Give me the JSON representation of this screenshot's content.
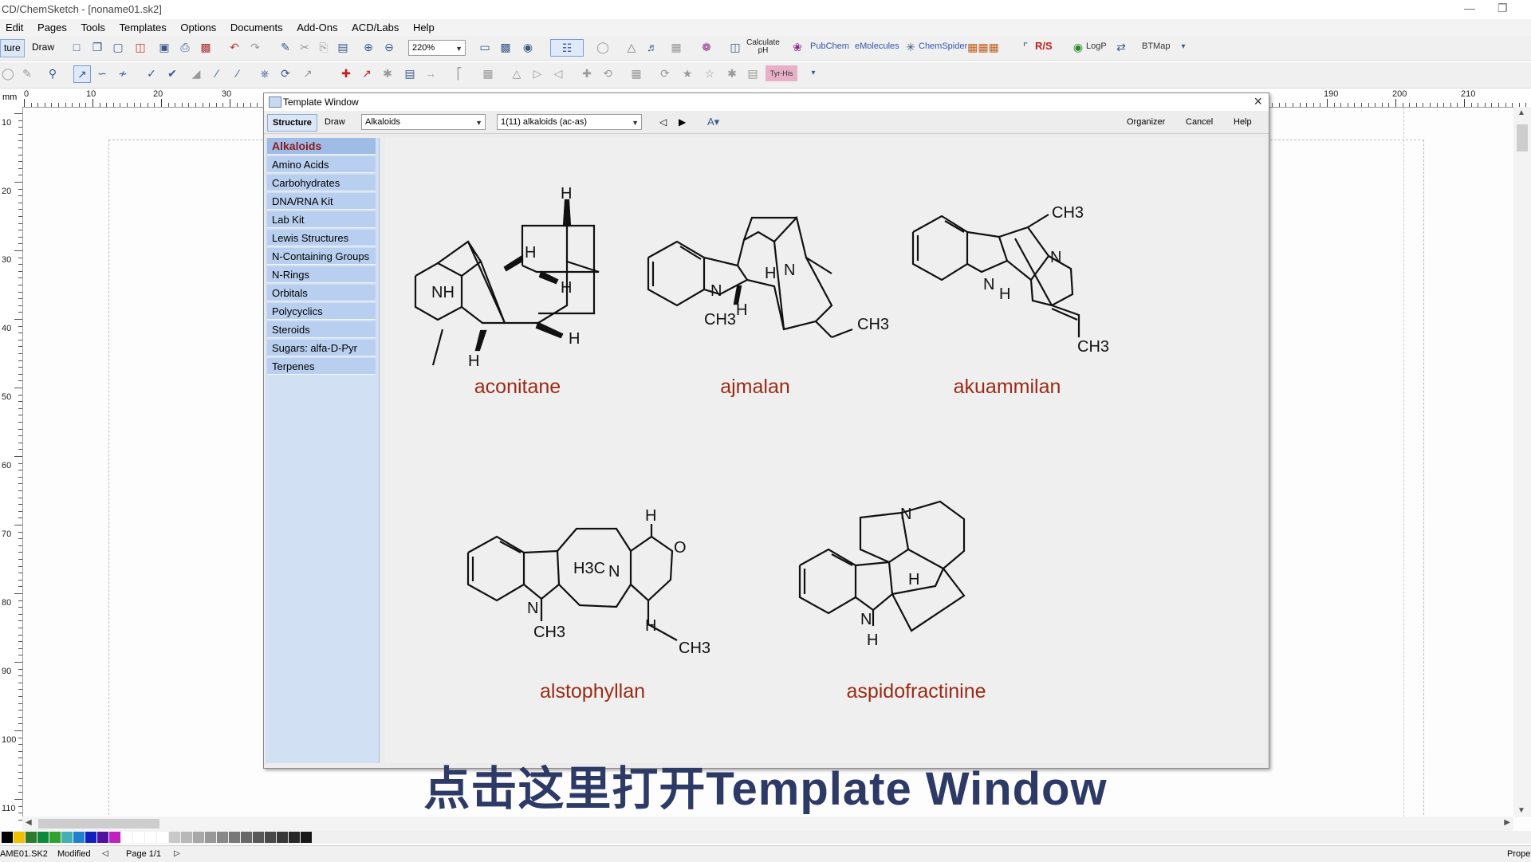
{
  "window": {
    "title": "CD/ChemSketch - [noname01.sk2]"
  },
  "menu": [
    "Edit",
    "Pages",
    "Tools",
    "Templates",
    "Options",
    "Documents",
    "Add-Ons",
    "ACD/Labs",
    "Help"
  ],
  "toolbar": {
    "structure_mode": "ture",
    "draw_mode": "Draw",
    "zoom": "220%",
    "calculate_label": "Calculate pH",
    "pubchem": "PubChem",
    "emolecules": "eMolecules",
    "chemspider": "ChemSpider",
    "rs": "R/S",
    "logp": "LogP",
    "btmap": "BTMap",
    "tyrhis": "Tyr-His"
  },
  "ruler": {
    "unit": "mm",
    "top_labels": [
      "0",
      "10",
      "20",
      "30",
      "190",
      "200",
      "210"
    ],
    "left_labels": [
      "10",
      "20",
      "30",
      "40",
      "50",
      "60",
      "70",
      "80",
      "90",
      "100",
      "110"
    ]
  },
  "template_window": {
    "title": "Template Window",
    "tab_structure": "Structure",
    "tab_draw": "Draw",
    "category_value": "Alkaloids",
    "page_value": "1(11) alkaloids (ac-as)",
    "organizer": "Organizer",
    "cancel": "Cancel",
    "help": "Help",
    "categories": [
      "Alkaloids",
      "Amino Acids",
      "Carbohydrates",
      "DNA/RNA Kit",
      "Lab Kit",
      "Lewis Structures",
      "N-Containing Groups",
      "N-Rings",
      "Orbitals",
      "Polycyclics",
      "Steroids",
      "Sugars: alfa-D-Pyr",
      "Terpenes"
    ],
    "selected_category": "Alkaloids",
    "molecules": [
      "aconitane",
      "ajmalan",
      "akuammilan",
      "alstophyllan",
      "aspidofractinine"
    ],
    "atom_labels": {
      "H": "H",
      "NH": "NH",
      "N": "N",
      "CH3": "CH3",
      "H3C": "H3C",
      "O": "O"
    }
  },
  "caption": "点击这里打开Template Window",
  "statusbar": {
    "file": "AME01.SK2",
    "state": "Modified",
    "page": "Page 1/1",
    "right": "Prope"
  },
  "colors": {
    "accent": "#3a5a8c",
    "list_bg": "#d2e0f4",
    "list_selected": "#8c1a1a",
    "mol_name": "#9b2a16",
    "caption": "#2d3a66"
  }
}
